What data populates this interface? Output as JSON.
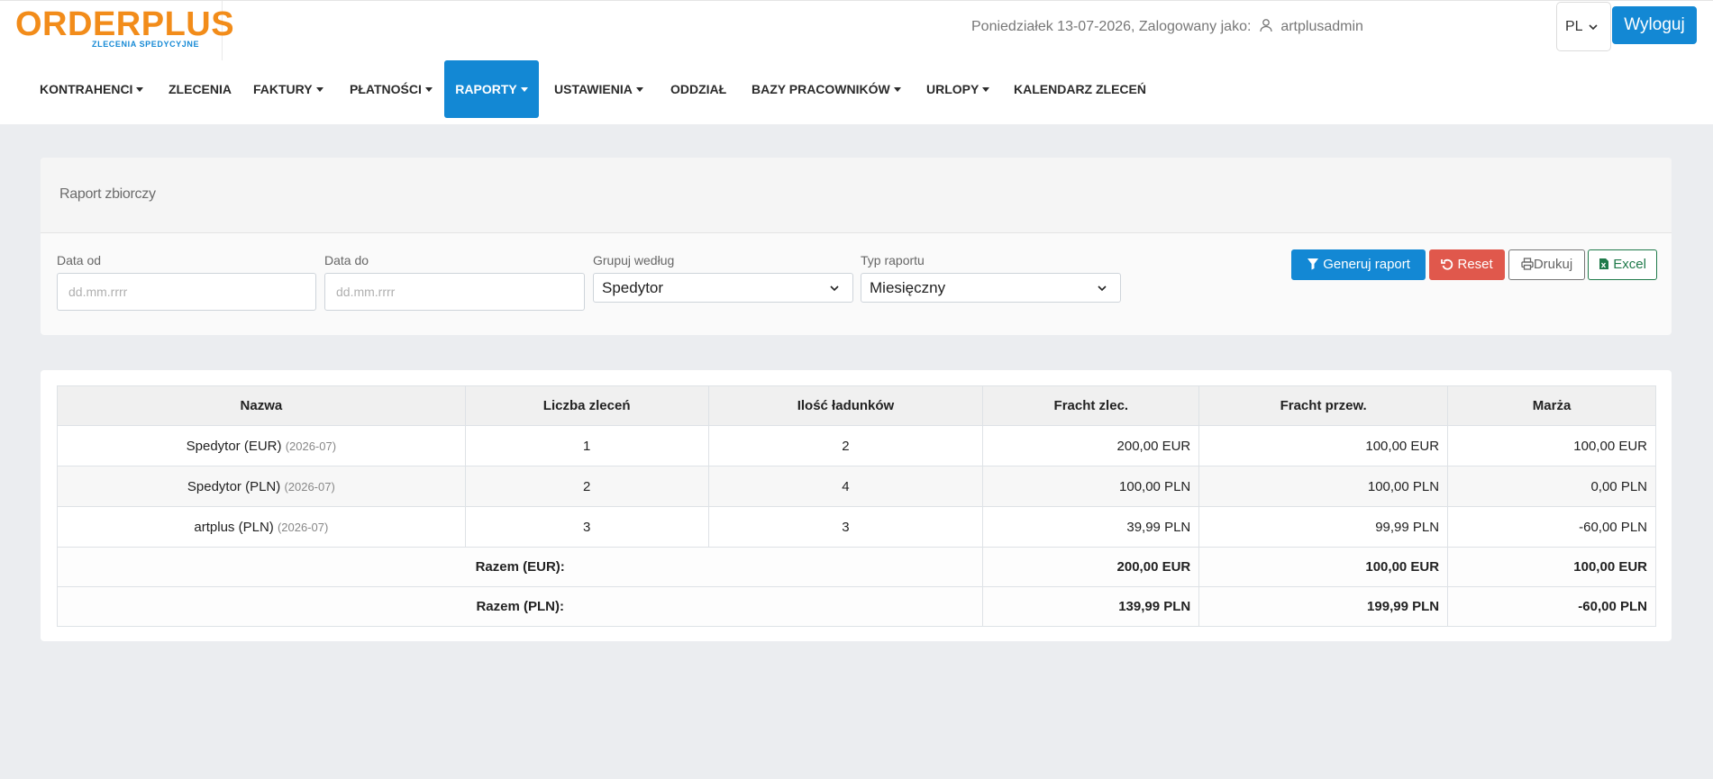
{
  "logo": {
    "brand": "ORDERPLUS",
    "tagline": "ZLECENIA SPEDYCYJNE"
  },
  "header": {
    "date_text": "Poniedziałek 13-07-2026, Zalogowany jako:",
    "username": "artplusadmin",
    "language": "PL",
    "logout_label": "Wyloguj"
  },
  "nav": {
    "items": [
      {
        "label": "KONTRAHENCI",
        "dropdown": true
      },
      {
        "label": "ZLECENIA",
        "dropdown": false
      },
      {
        "label": "FAKTURY",
        "dropdown": true
      },
      {
        "label": "PŁATNOŚCI",
        "dropdown": true
      },
      {
        "label": "RAPORTY",
        "dropdown": true,
        "active": true
      },
      {
        "label": "USTAWIENIA",
        "dropdown": true
      },
      {
        "label": "ODDZIAŁ",
        "dropdown": false
      },
      {
        "label": "BAZY PRACOWNIKÓW",
        "dropdown": true
      },
      {
        "label": "URLOPY",
        "dropdown": true
      },
      {
        "label": "KALENDARZ ZLECEŃ",
        "dropdown": false
      }
    ]
  },
  "filters": {
    "card_title": "Raport zbiorczy",
    "date_from": {
      "label": "Data od",
      "placeholder": "dd.mm.rrrr"
    },
    "date_to": {
      "label": "Data do",
      "placeholder": "dd.mm.rrrr"
    },
    "group_by": {
      "label": "Grupuj według",
      "value": "Spedytor"
    },
    "report_type": {
      "label": "Typ raportu",
      "value": "Miesięczny"
    },
    "buttons": {
      "generate": "Generuj raport",
      "reset": "Reset",
      "print": "Drukuj",
      "excel": "Excel"
    }
  },
  "table": {
    "headers": [
      "Nazwa",
      "Liczba zleceń",
      "Ilość ładunków",
      "Fracht zlec.",
      "Fracht przew.",
      "Marża"
    ],
    "rows": [
      {
        "name": "Spedytor (EUR)",
        "period": "(2026-07)",
        "orders": "1",
        "loads": "2",
        "freight_order": "200,00 EUR",
        "freight_carrier": "100,00 EUR",
        "margin": "100,00 EUR"
      },
      {
        "name": "Spedytor (PLN)",
        "period": "(2026-07)",
        "orders": "2",
        "loads": "4",
        "freight_order": "100,00 PLN",
        "freight_carrier": "100,00 PLN",
        "margin": "0,00 PLN"
      },
      {
        "name": "artplus (PLN)",
        "period": "(2026-07)",
        "orders": "3",
        "loads": "3",
        "freight_order": "39,99 PLN",
        "freight_carrier": "99,99 PLN",
        "margin": "-60,00 PLN"
      }
    ],
    "totals": [
      {
        "label": "Razem (EUR):",
        "freight_order": "200,00 EUR",
        "freight_carrier": "100,00 EUR",
        "margin": "100,00 EUR"
      },
      {
        "label": "Razem (PLN):",
        "freight_order": "139,99 PLN",
        "freight_carrier": "199,99 PLN",
        "margin": "-60,00 PLN"
      }
    ]
  },
  "colors": {
    "brand_orange": "#f28c1a",
    "primary_blue": "#1388d4",
    "danger_red": "#e0584c",
    "excel_green": "#1f7a4a"
  }
}
